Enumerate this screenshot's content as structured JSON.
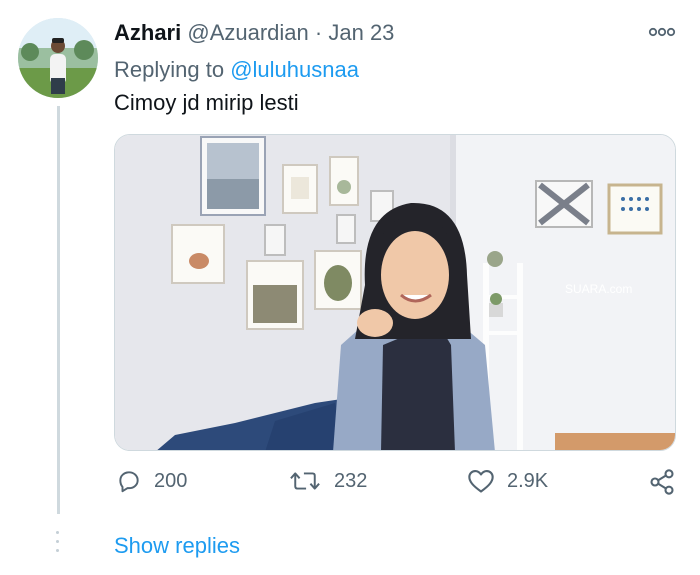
{
  "tweet": {
    "display_name": "Azhari",
    "handle": "@Azuardian",
    "separator": "·",
    "date": "Jan 23",
    "more_icon": "more-horizontal-icon",
    "replying_label": "Replying to",
    "replying_to": "@luluhusnaa",
    "text": "Cimoy jd mirip lesti",
    "media_watermark": "SUARA.com"
  },
  "actions": {
    "reply": {
      "icon": "reply-icon",
      "count": "200"
    },
    "retweet": {
      "icon": "retweet-icon",
      "count": "232"
    },
    "like": {
      "icon": "heart-icon",
      "count": "2.9K"
    },
    "share": {
      "icon": "share-icon"
    }
  },
  "thread": {
    "show_replies_label": "Show replies"
  },
  "colors": {
    "link": "#1d9bf0",
    "muted": "#536471",
    "text": "#0f1419"
  }
}
